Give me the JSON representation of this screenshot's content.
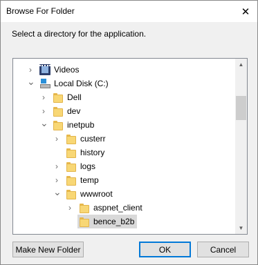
{
  "window": {
    "title": "Browse For Folder",
    "close_icon": "close-icon"
  },
  "instruction": "Select a directory for the application.",
  "tree": {
    "items": [
      {
        "label": "Videos",
        "icon": "videos-icon",
        "state": "collapsed",
        "level": 1
      },
      {
        "label": "Local Disk (C:)",
        "icon": "local-disk-icon",
        "state": "expanded",
        "level": 1
      },
      {
        "label": "Dell",
        "icon": "folder-icon",
        "state": "collapsed",
        "level": 2
      },
      {
        "label": "dev",
        "icon": "folder-icon",
        "state": "collapsed",
        "level": 2
      },
      {
        "label": "inetpub",
        "icon": "folder-icon",
        "state": "expanded",
        "level": 2
      },
      {
        "label": "custerr",
        "icon": "folder-icon",
        "state": "collapsed",
        "level": 3
      },
      {
        "label": "history",
        "icon": "folder-icon",
        "state": "none",
        "level": 3
      },
      {
        "label": "logs",
        "icon": "folder-icon",
        "state": "collapsed",
        "level": 3
      },
      {
        "label": "temp",
        "icon": "folder-icon",
        "state": "collapsed",
        "level": 3
      },
      {
        "label": "wwwroot",
        "icon": "folder-icon",
        "state": "expanded",
        "level": 3
      },
      {
        "label": "aspnet_client",
        "icon": "folder-icon",
        "state": "collapsed",
        "level": 4
      },
      {
        "label": "bence_b2b",
        "icon": "folder-icon",
        "state": "none",
        "level": 4,
        "selected": true
      }
    ]
  },
  "buttons": {
    "new_folder": "Make New Folder",
    "ok": "OK",
    "cancel": "Cancel"
  },
  "colors": {
    "accent": "#0078d7",
    "folder": "#f8d775",
    "selection": "#d9d9d9"
  }
}
